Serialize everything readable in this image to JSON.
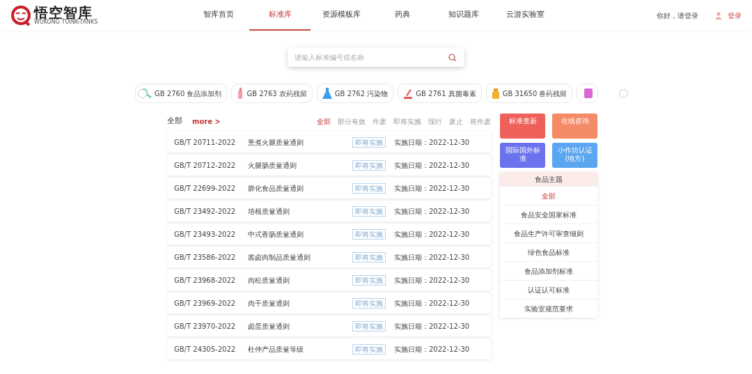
{
  "header": {
    "logo_title": "悟空智库",
    "logo_subtitle": "WUKONG TUINK-TANKS",
    "nav": [
      {
        "label": "智库首页",
        "selected": false
      },
      {
        "label": "标准库",
        "selected": true
      },
      {
        "label": "资源模板库",
        "selected": false
      },
      {
        "label": "药典",
        "selected": false
      },
      {
        "label": "知识题库",
        "selected": false
      },
      {
        "label": "云游实验室",
        "selected": false
      }
    ],
    "greeting": "你好，请登录",
    "login": "登录"
  },
  "search": {
    "placeholder": "请输入标准编号或名称"
  },
  "chips": [
    {
      "label": "GB 2760 食品添加剂"
    },
    {
      "label": "GB 2763 农药残留"
    },
    {
      "label": "GB 2762 污染物"
    },
    {
      "label": "GB 2761 真菌毒素"
    },
    {
      "label": "GB 31650 兽药残留"
    }
  ],
  "list": {
    "title": "全部",
    "more": "more >",
    "filters": [
      {
        "label": "全部",
        "selected": true
      },
      {
        "label": "部分有效",
        "selected": false
      },
      {
        "label": "作废",
        "selected": false
      },
      {
        "label": "即将实施",
        "selected": false
      },
      {
        "label": "现行",
        "selected": false
      },
      {
        "label": "废止",
        "selected": false
      },
      {
        "label": "将作废",
        "selected": false
      }
    ],
    "rows": [
      {
        "code": "GB/T 20711-2022",
        "name": "熏煮火腿质量通则",
        "status": "即将实施",
        "date": "实施日期：2022-12-30"
      },
      {
        "code": "GB/T 20712-2022",
        "name": "火腿肠质量通则",
        "status": "即将实施",
        "date": "实施日期：2022-12-30"
      },
      {
        "code": "GB/T 22699-2022",
        "name": "膨化食品质量通则",
        "status": "即将实施",
        "date": "实施日期：2022-12-30"
      },
      {
        "code": "GB/T 23492-2022",
        "name": "培根质量通则",
        "status": "即将实施",
        "date": "实施日期：2022-12-30"
      },
      {
        "code": "GB/T 23493-2022",
        "name": "中式香肠质量通则",
        "status": "即将实施",
        "date": "实施日期：2022-12-30"
      },
      {
        "code": "GB/T 23586-2022",
        "name": "酱卤肉制品质量通则",
        "status": "即将实施",
        "date": "实施日期：2022-12-30"
      },
      {
        "code": "GB/T 23968-2022",
        "name": "肉松质量通则",
        "status": "即将实施",
        "date": "实施日期：2022-12-30"
      },
      {
        "code": "GB/T 23969-2022",
        "name": "肉干质量通则",
        "status": "即将实施",
        "date": "实施日期：2022-12-30"
      },
      {
        "code": "GB/T 23970-2022",
        "name": "卤蛋质量通则",
        "status": "即将实施",
        "date": "实施日期：2022-12-30"
      },
      {
        "code": "GB/T 24305-2022",
        "name": "杜仲产品质量等级",
        "status": "即将实施",
        "date": "实施日期：2022-12-30"
      }
    ]
  },
  "tiles": [
    {
      "label": "标准查新",
      "color": "#f0605a"
    },
    {
      "label": "在线咨询",
      "color": "#f58a66"
    },
    {
      "label": "国际国外标准",
      "color": "#6a72ee"
    },
    {
      "label": "小作坊认证(地方)",
      "color": "#5aa6f0"
    }
  ],
  "topics": {
    "title": "食品主题",
    "items": [
      {
        "label": "全部",
        "selected": true
      },
      {
        "label": "食品安全国家标准",
        "selected": false
      },
      {
        "label": "食品生产许可审查细则",
        "selected": false
      },
      {
        "label": "绿色食品标准",
        "selected": false
      },
      {
        "label": "食品添加剂标准",
        "selected": false
      },
      {
        "label": "认证认可标准",
        "selected": false
      },
      {
        "label": "实验室规范要求",
        "selected": false
      }
    ]
  }
}
